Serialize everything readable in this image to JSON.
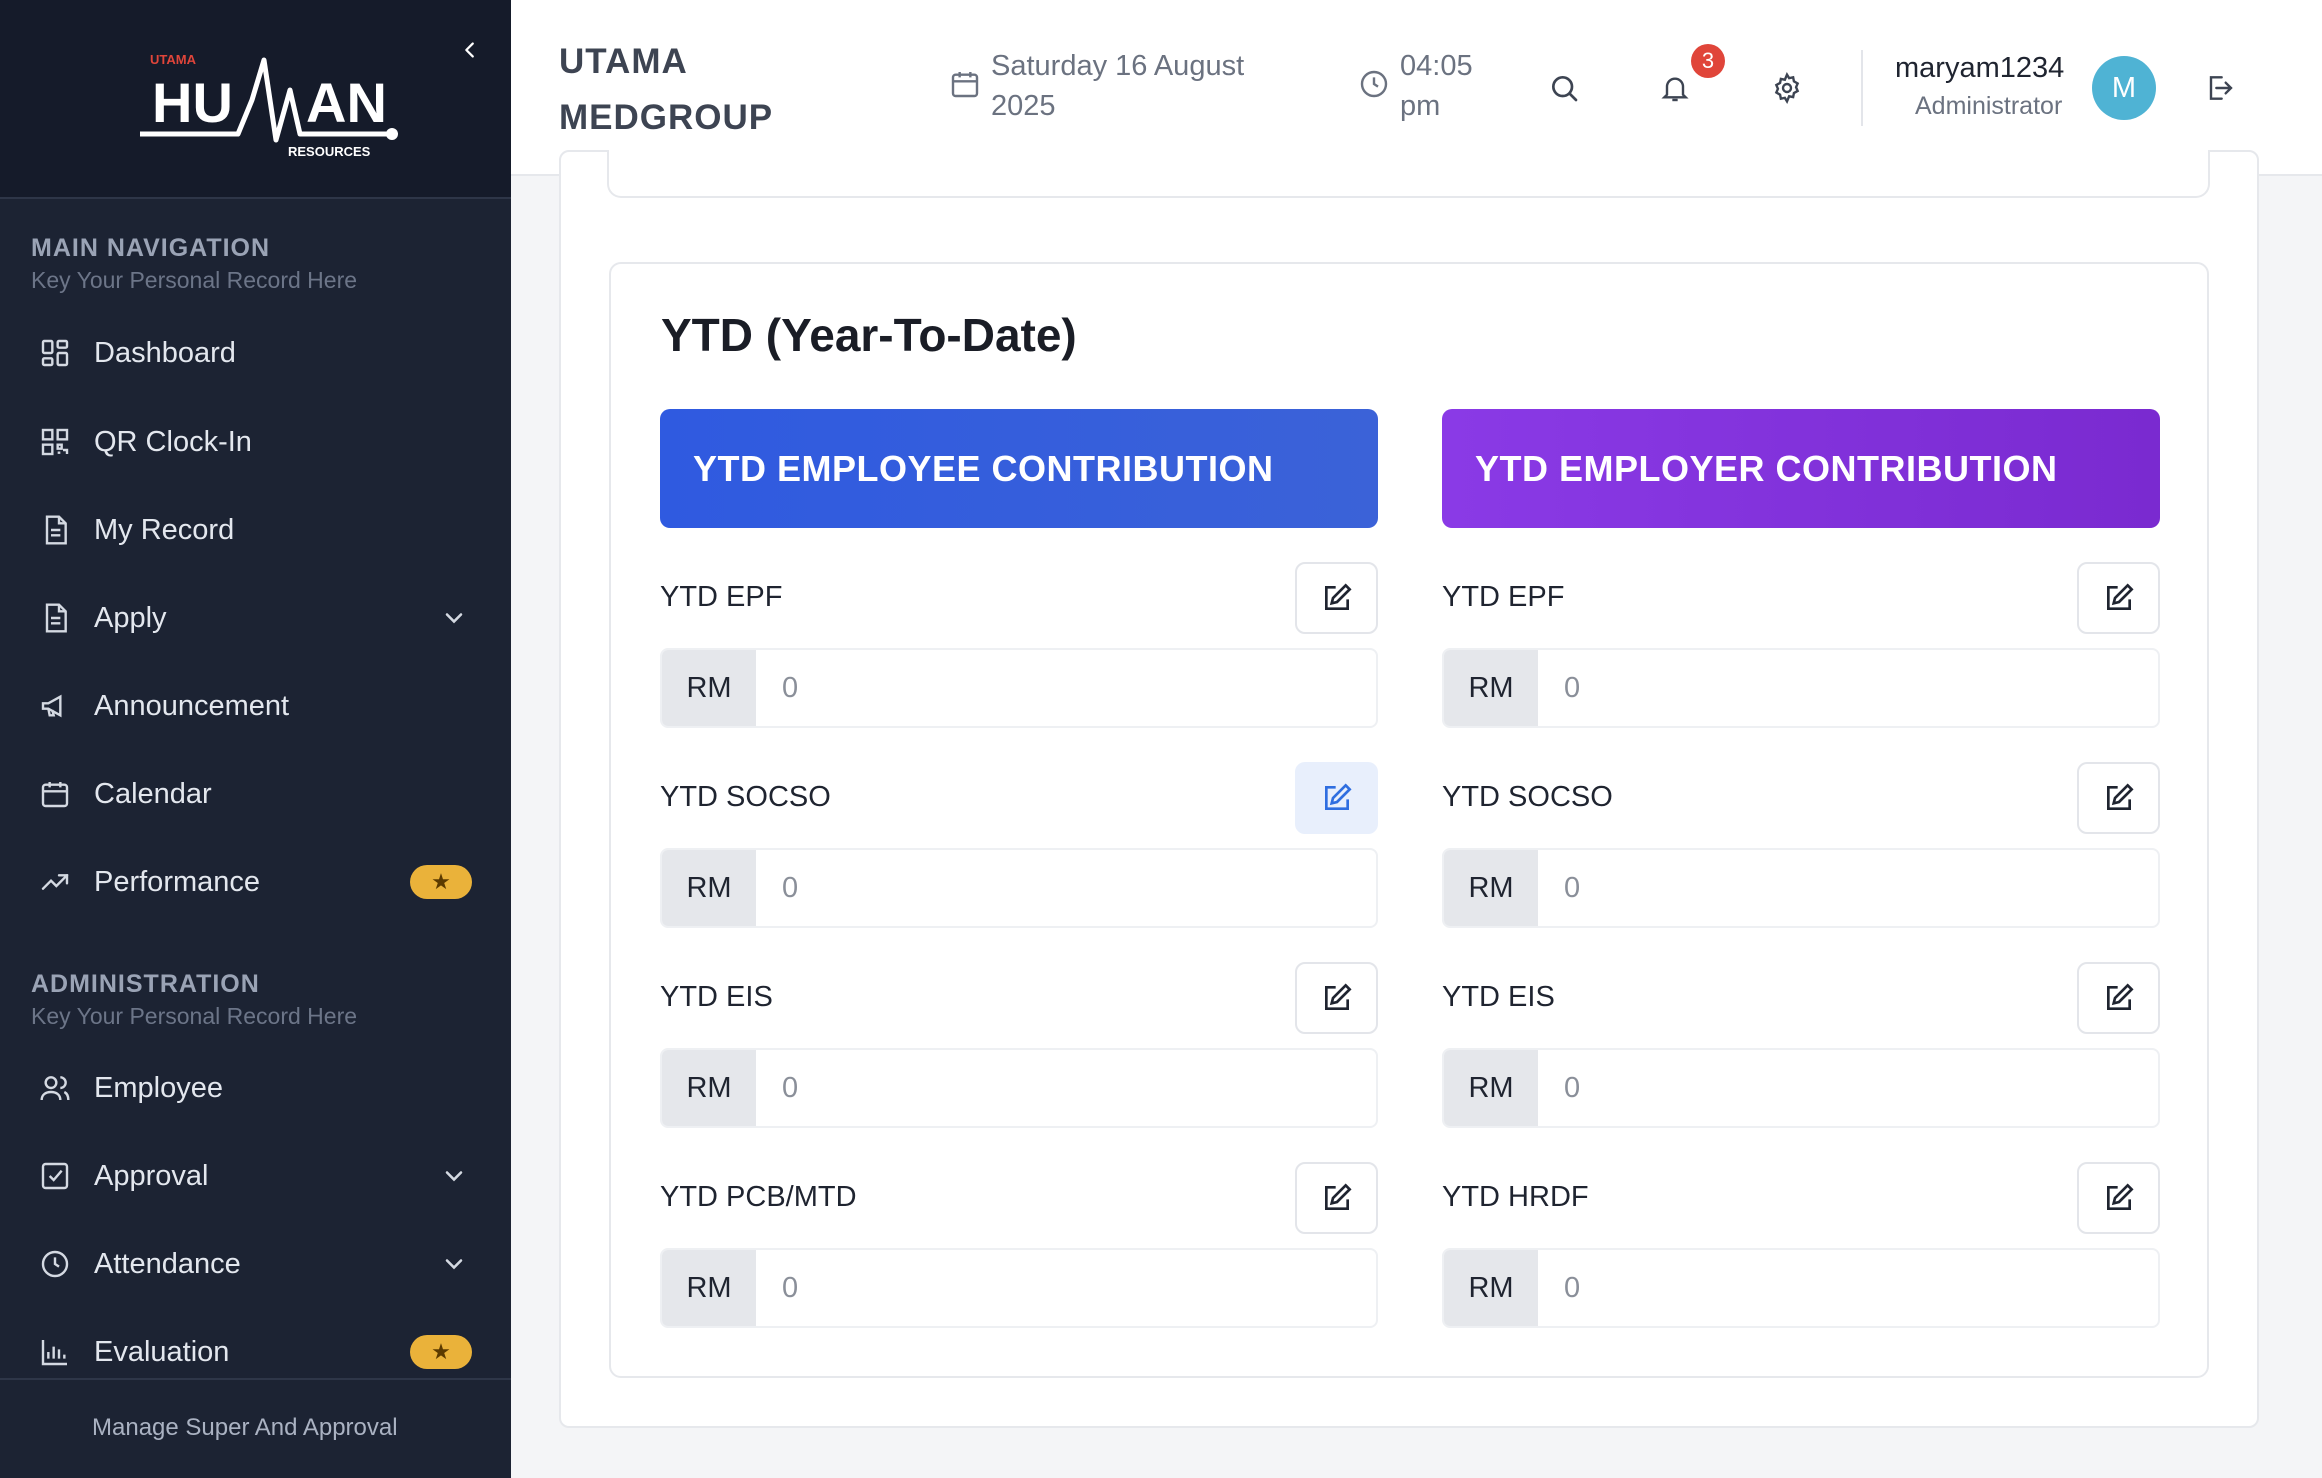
{
  "brand": {
    "logo_small": "UTAMA",
    "logo_main_left": "HU",
    "logo_main_right": "AN",
    "logo_sub": "RESOURCES"
  },
  "sidebar": {
    "main_nav_title": "MAIN NAVIGATION",
    "main_nav_sub": "Key Your Personal Record Here",
    "main_items": [
      {
        "label": "Dashboard",
        "icon": "dashboard-icon"
      },
      {
        "label": "QR Clock-In",
        "icon": "qr-code-icon"
      },
      {
        "label": "My Record",
        "icon": "document-icon"
      },
      {
        "label": "Apply",
        "icon": "document-icon",
        "expandable": true
      },
      {
        "label": "Announcement",
        "icon": "megaphone-icon"
      },
      {
        "label": "Calendar",
        "icon": "calendar-icon"
      },
      {
        "label": "Performance",
        "icon": "trending-up-icon",
        "badge": "★"
      }
    ],
    "admin_title": "ADMINISTRATION",
    "admin_sub": "Key Your Personal Record Here",
    "admin_items": [
      {
        "label": "Employee",
        "icon": "users-icon"
      },
      {
        "label": "Approval",
        "icon": "checkbox-icon",
        "expandable": true
      },
      {
        "label": "Attendance",
        "icon": "clock-icon",
        "expandable": true
      },
      {
        "label": "Evaluation",
        "icon": "bar-chart-icon",
        "badge": "★"
      }
    ],
    "footer": "Manage Super And Approval"
  },
  "header": {
    "company": "UTAMA MEDGROUP",
    "date": "Saturday 16 August 2025",
    "time": "04:05 pm",
    "notification_count": "3",
    "user_name": "maryam1234",
    "user_role": "Administrator",
    "avatar_initial": "M"
  },
  "ytd": {
    "title": "YTD (Year-To-Date)",
    "employee_banner": "YTD EMPLOYEE CONTRIBUTION",
    "employer_banner": "YTD EMPLOYER CONTRIBUTION",
    "currency": "RM",
    "employee_fields": [
      {
        "label": "YTD EPF",
        "value": "0"
      },
      {
        "label": "YTD SOCSO",
        "value": "0"
      },
      {
        "label": "YTD EIS",
        "value": "0"
      },
      {
        "label": "YTD PCB/MTD",
        "value": "0"
      }
    ],
    "employer_fields": [
      {
        "label": "YTD EPF",
        "value": "0"
      },
      {
        "label": "YTD SOCSO",
        "value": "0"
      },
      {
        "label": "YTD EIS",
        "value": "0"
      },
      {
        "label": "YTD HRDF",
        "value": "0"
      }
    ]
  },
  "colors": {
    "sidebar_bg": "#1c2333",
    "employee_accent": "#2f5ae0",
    "employer_accent": "#8a3ae6",
    "badge_gold": "#eab23a",
    "notification_red": "#e0453a",
    "avatar_blue": "#4fb3d4"
  }
}
